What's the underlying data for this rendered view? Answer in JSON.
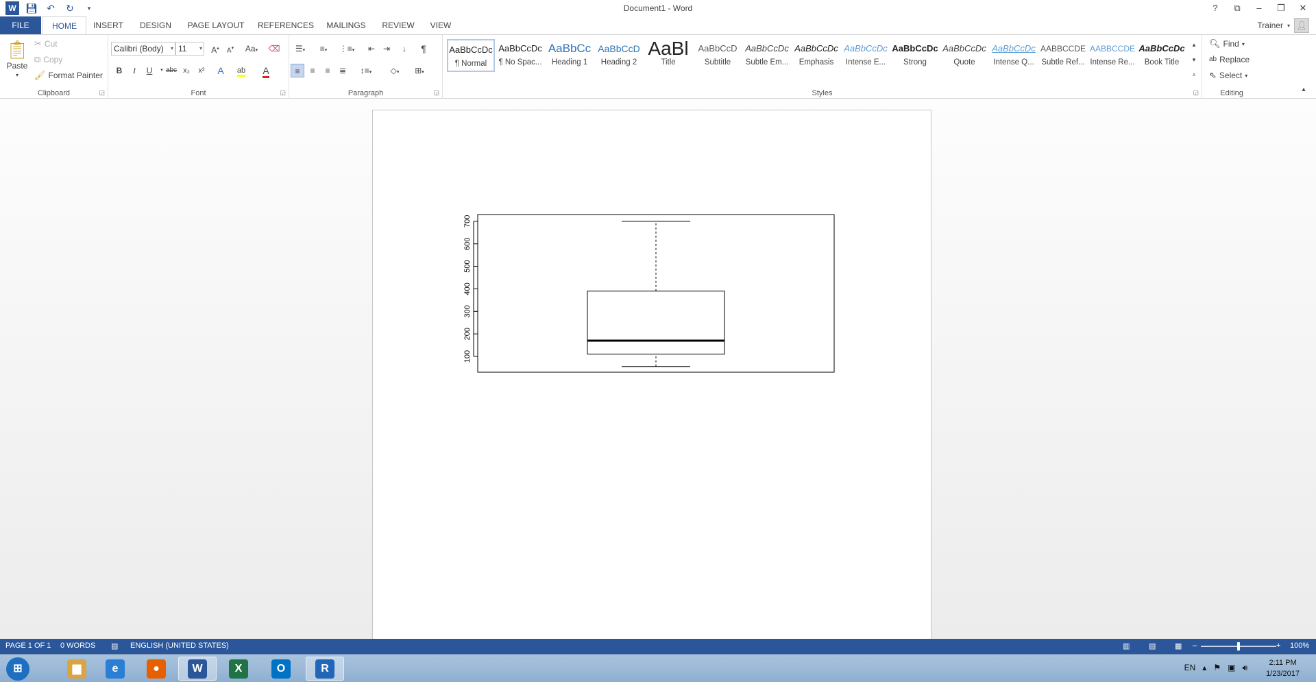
{
  "title_bar": {
    "title": "Document1 - Word",
    "qat_icons": [
      "word-app-icon",
      "save-icon",
      "undo-icon",
      "redo-icon",
      "customize-qat-icon"
    ],
    "controls": {
      "help": "?",
      "ribbon_options": "⧉",
      "minimize": "–",
      "restore": "❐",
      "close": "✕"
    }
  },
  "tabs": {
    "file": "FILE",
    "items": [
      "HOME",
      "INSERT",
      "DESIGN",
      "PAGE LAYOUT",
      "REFERENCES",
      "MAILINGS",
      "REVIEW",
      "VIEW"
    ],
    "active": "HOME"
  },
  "user": {
    "name": "Trainer"
  },
  "ribbon": {
    "clipboard": {
      "label": "Clipboard",
      "paste": "Paste",
      "cut": "Cut",
      "copy": "Copy",
      "format_painter": "Format Painter"
    },
    "font": {
      "label": "Font",
      "font_name": "Calibri (Body)",
      "font_size": "11",
      "change_case": "Aa",
      "grow": "A",
      "shrink": "A",
      "bold": "B",
      "italic": "I",
      "underline": "U",
      "strikethrough": "abc",
      "subscript": "x₂",
      "superscript": "x²",
      "text_effects": "A",
      "highlight": "ab",
      "font_color": "A",
      "font_color_value": "#e02020",
      "highlight_color_value": "#ffff00"
    },
    "paragraph": {
      "label": "Paragraph",
      "show_marks": "¶"
    },
    "styles": {
      "label": "Styles",
      "items": [
        {
          "preview": "AaBbCcDc",
          "name": "¶ Normal"
        },
        {
          "preview": "AaBbCcDc",
          "name": "¶ No Spac..."
        },
        {
          "preview": "AaBbCc",
          "name": "Heading 1"
        },
        {
          "preview": "AaBbCcD",
          "name": "Heading 2"
        },
        {
          "preview": "AaBl",
          "name": "Title"
        },
        {
          "preview": "AaBbCcD",
          "name": "Subtitle"
        },
        {
          "preview": "AaBbCcDc",
          "name": "Subtle Em..."
        },
        {
          "preview": "AaBbCcDc",
          "name": "Emphasis"
        },
        {
          "preview": "AaBbCcDc",
          "name": "Intense E..."
        },
        {
          "preview": "AaBbCcDc",
          "name": "Strong"
        },
        {
          "preview": "AaBbCcDc",
          "name": "Quote"
        },
        {
          "preview": "AaBbCcDc",
          "name": "Intense Q..."
        },
        {
          "preview": "AABBCCDE",
          "name": "Subtle Ref..."
        },
        {
          "preview": "AABBCCDE",
          "name": "Intense Re..."
        },
        {
          "preview": "AaBbCcDc",
          "name": "Book Title"
        }
      ]
    },
    "editing": {
      "label": "Editing",
      "find": "Find",
      "replace": "Replace",
      "select": "Select"
    }
  },
  "chart_data": {
    "type": "boxplot",
    "title": "",
    "xlabel": "",
    "ylabel": "",
    "ylim": [
      30,
      730
    ],
    "yticks": [
      "100",
      "200",
      "300",
      "400",
      "500",
      "600",
      "700"
    ],
    "series": [
      {
        "min": 55,
        "q1": 110,
        "median": 170,
        "q3": 390,
        "max": 700
      }
    ],
    "grid": false
  },
  "status_bar": {
    "page": "PAGE 1 OF 1",
    "words": "0 WORDS",
    "language": "ENGLISH (UNITED STATES)",
    "zoom": "100%",
    "zoom_minus": "–",
    "zoom_plus": "+"
  },
  "taskbar": {
    "apps": [
      {
        "name": "start-button",
        "glyph": "⊞",
        "color": "#1e6fbf"
      },
      {
        "name": "file-explorer",
        "glyph": "▆",
        "color": "#d9a441"
      },
      {
        "name": "internet-explorer",
        "glyph": "e",
        "color": "#2a7fd4"
      },
      {
        "name": "firefox",
        "glyph": "●",
        "color": "#e66000"
      },
      {
        "name": "word",
        "glyph": "W",
        "color": "#2b579a"
      },
      {
        "name": "excel",
        "glyph": "X",
        "color": "#217346"
      },
      {
        "name": "outlook",
        "glyph": "O",
        "color": "#0072c6"
      },
      {
        "name": "r-gui",
        "glyph": "R",
        "color": "#2266b8"
      }
    ],
    "language": "EN",
    "time": "2:11 PM",
    "date": "1/23/2017"
  }
}
